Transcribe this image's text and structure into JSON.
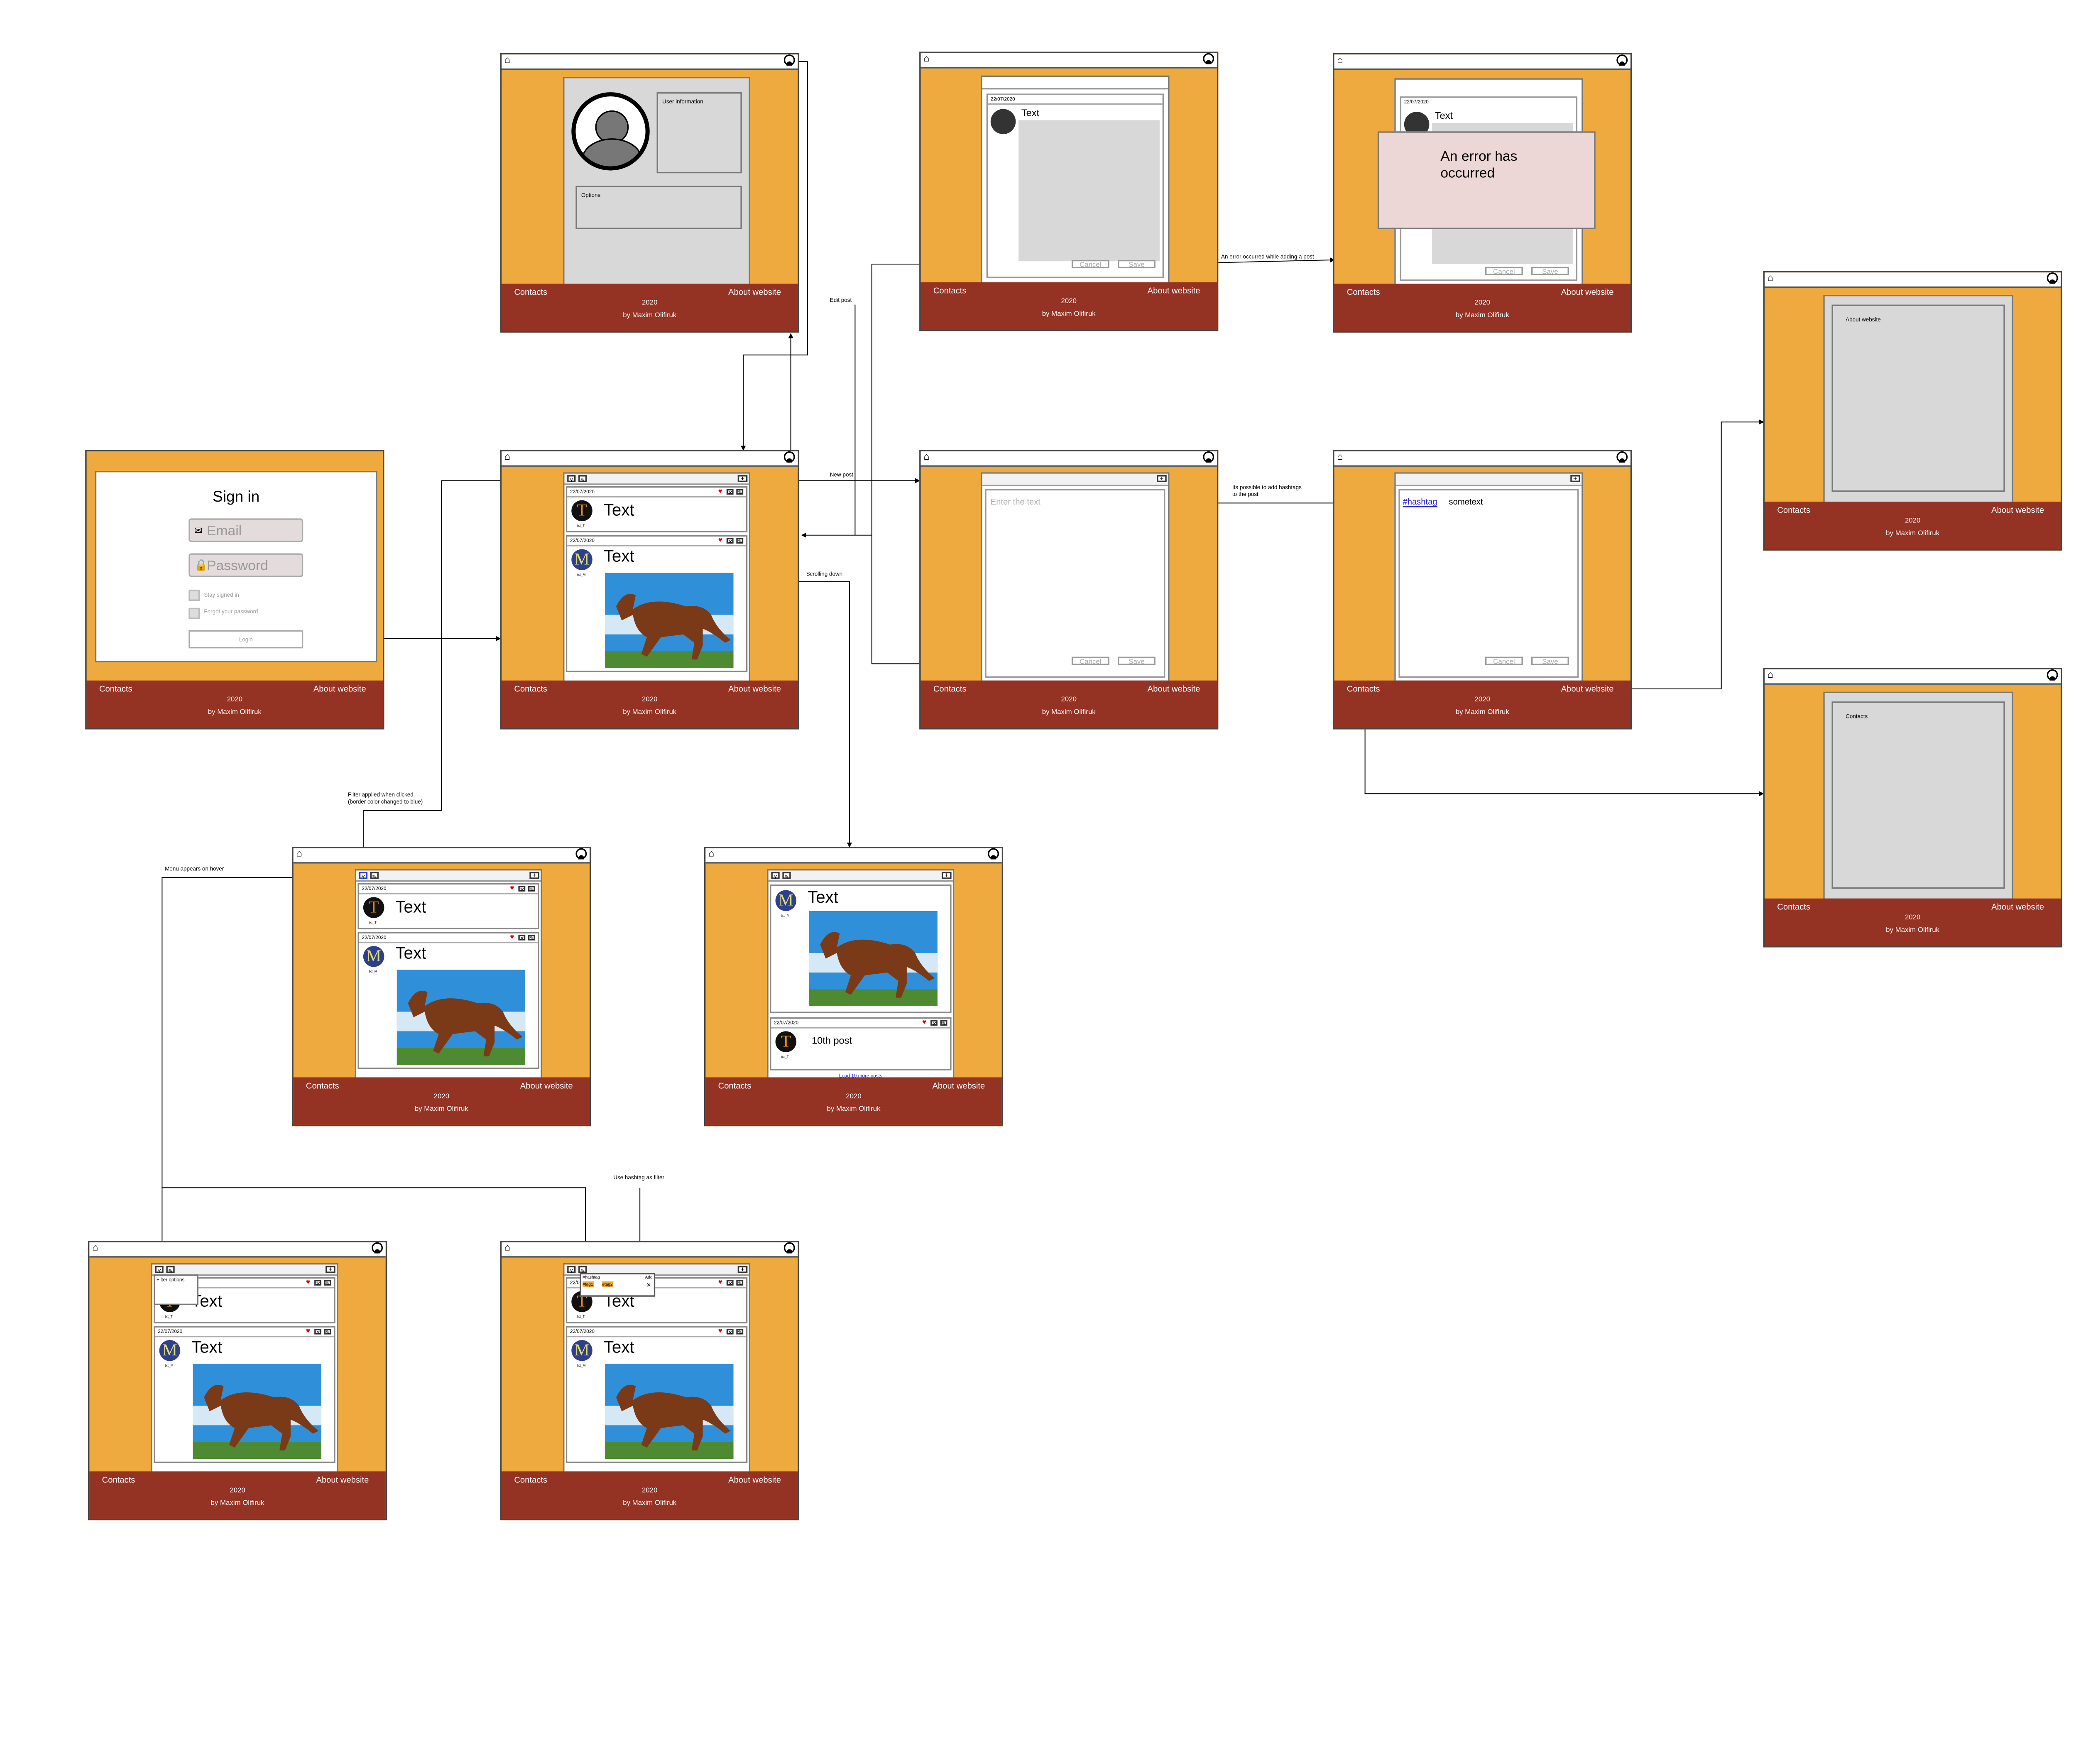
{
  "footer": {
    "contacts": "Contacts",
    "about": "About website",
    "year": "2020",
    "author": "by Maxim Olifiruk"
  },
  "post": {
    "date": "22/07/2020",
    "text": "Text",
    "tenth_text": "10th post",
    "av_t": "T",
    "av_m": "M",
    "av_t_sub": "txt_T",
    "av_m_sub": "txt_M"
  },
  "signin": {
    "title": "Sign in",
    "email_placeholder": "Email",
    "password_placeholder": "Password",
    "stay_signed": "Stay signed in",
    "forgot": "Forgot your password",
    "login": "Login"
  },
  "profile": {
    "user_info": "User information",
    "options": "Options"
  },
  "editor": {
    "enter_text": "Enter the text",
    "cancel": "Cancel",
    "save": "Save",
    "text": "Text",
    "hashtag": "#hashtag",
    "sometext": "sometext"
  },
  "error": {
    "message": "An error has occurred"
  },
  "about_page": {
    "label": "About website"
  },
  "contacts_page": {
    "label": "Contacts"
  },
  "feed": {
    "load_more": "Load 10 more posts"
  },
  "filter": {
    "options": "Filter options",
    "hashtag_label": "#hashtag",
    "add": "Add",
    "tag1": "#tag1",
    "tag2": "#tag2"
  },
  "annotations": {
    "edit_post": "Edit post",
    "error_adding": "An error occurred while adding a post",
    "new_post": "New post",
    "hashtag_possible_1": "Its possible to add hashtags",
    "hashtag_possible_2": "to the post",
    "scrolling_down": "Scrolling down",
    "filter_applied_1": "Filter applied when clicked",
    "filter_applied_2": "(border color changed to blue)",
    "menu_hover": "Menu appears on hover",
    "use_hashtag": "Use hashtag as filter"
  },
  "colors": {
    "orange": "#eeaa3e",
    "footer": "#943224",
    "panel_gray": "#d8d8d8",
    "error_bg": "#ecd6d6",
    "link_blue": "#2222cc"
  },
  "icons": {
    "home": "home-icon",
    "user": "user-icon",
    "filter": "filter-icon",
    "edit": "pencil-icon",
    "add": "plus-icon",
    "like": "heart-icon",
    "delete": "close-icon"
  }
}
